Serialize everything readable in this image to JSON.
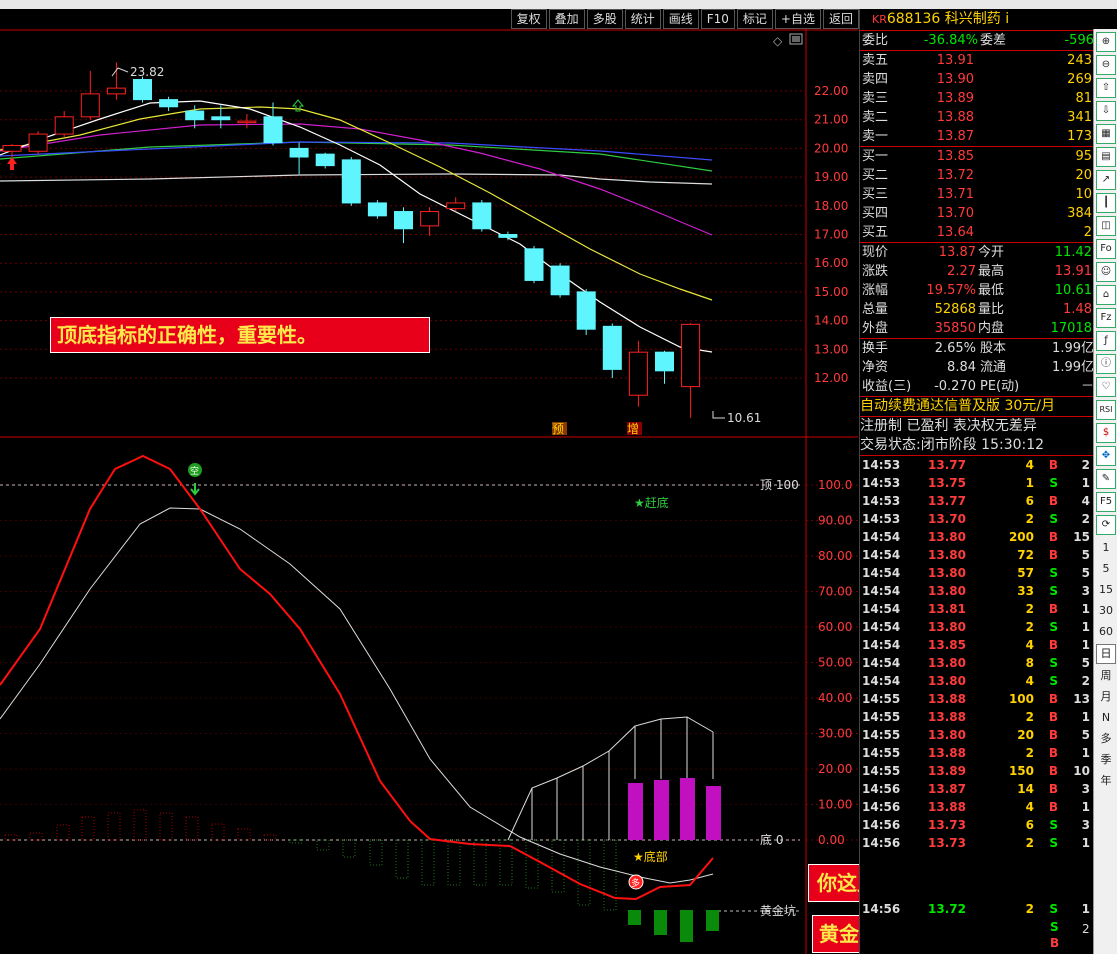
{
  "toolbar": [
    "复权",
    "叠加",
    "多股",
    "统计",
    "画线",
    "F10",
    "标记",
    "+自选",
    "返回"
  ],
  "chart": {
    "price_axis": [
      "22.00",
      "21.00",
      "20.00",
      "19.00",
      "18.00",
      "17.00",
      "16.00",
      "15.00",
      "14.00",
      "13.00",
      "12.00"
    ],
    "high_label": "23.82",
    "low_label": "10.61",
    "sig_yu": "预",
    "sig_zeng": "增",
    "indicator_axis": [
      "100.0",
      "90.00",
      "80.00",
      "70.00",
      "60.00",
      "50.00",
      "40.00",
      "30.00",
      "20.00",
      "10.00",
      "0.00"
    ],
    "top_label": "顶 100",
    "bottom_label": "底 0",
    "gold_label": "黄金坑",
    "gandi_label": "★赶底",
    "dibu_label": "★底部",
    "candles": [
      {
        "o": 19.9,
        "c": 20.1,
        "h": 20.15,
        "l": 19.7
      },
      {
        "o": 19.9,
        "c": 20.5,
        "h": 20.6,
        "l": 19.8
      },
      {
        "o": 20.5,
        "c": 21.1,
        "h": 21.3,
        "l": 20.4
      },
      {
        "o": 21.1,
        "c": 21.9,
        "h": 22.7,
        "l": 21.0
      },
      {
        "o": 21.9,
        "c": 22.1,
        "h": 23.0,
        "l": 21.7
      },
      {
        "o": 22.4,
        "c": 21.7,
        "h": 22.5,
        "l": 21.6
      },
      {
        "o": 21.7,
        "c": 21.45,
        "h": 21.8,
        "l": 21.3
      },
      {
        "o": 21.3,
        "c": 21.0,
        "h": 21.5,
        "l": 20.7
      },
      {
        "o": 21.1,
        "c": 21.0,
        "h": 21.5,
        "l": 20.7
      },
      {
        "o": 20.9,
        "c": 20.95,
        "h": 21.2,
        "l": 20.7
      },
      {
        "o": 21.1,
        "c": 20.2,
        "h": 21.6,
        "l": 20.1
      },
      {
        "o": 20.0,
        "c": 19.7,
        "h": 20.2,
        "l": 19.1
      },
      {
        "o": 19.8,
        "c": 19.4,
        "h": 19.85,
        "l": 19.3
      },
      {
        "o": 19.6,
        "c": 18.1,
        "h": 19.7,
        "l": 18.0
      },
      {
        "o": 18.1,
        "c": 17.65,
        "h": 18.2,
        "l": 17.55
      },
      {
        "o": 17.8,
        "c": 17.2,
        "h": 17.95,
        "l": 16.7
      },
      {
        "o": 17.3,
        "c": 17.8,
        "h": 17.95,
        "l": 16.95
      },
      {
        "o": 17.9,
        "c": 18.1,
        "h": 18.3,
        "l": 17.8
      },
      {
        "o": 18.1,
        "c": 17.2,
        "h": 18.2,
        "l": 17.1
      },
      {
        "o": 17.0,
        "c": 16.9,
        "h": 17.1,
        "l": 16.8
      },
      {
        "o": 16.5,
        "c": 15.4,
        "h": 16.6,
        "l": 15.3
      },
      {
        "o": 15.9,
        "c": 14.9,
        "h": 16.0,
        "l": 14.8
      },
      {
        "o": 15.0,
        "c": 13.7,
        "h": 15.1,
        "l": 13.5
      },
      {
        "o": 13.8,
        "c": 12.3,
        "h": 13.9,
        "l": 12.0
      },
      {
        "o": 11.4,
        "c": 12.9,
        "h": 13.3,
        "l": 11.0
      },
      {
        "o": 12.9,
        "c": 12.25,
        "h": 12.95,
        "l": 11.8
      },
      {
        "o": 11.7,
        "c": 13.87,
        "h": 13.91,
        "l": 10.61
      }
    ]
  },
  "banners": {
    "b1": "顶底指标的正确性，重要性。",
    "b2": "你这里割肉了吗？？",
    "b3": "黄金坑就是恐慌盘"
  },
  "panel": {
    "kr": "KR",
    "code_name": "688136 科兴制药",
    "suffix": "i",
    "weibi_label": "委比",
    "weibi": "-36.84%",
    "weicha_label": "委差",
    "weicha": "-596",
    "asks": [
      {
        "label": "卖五",
        "price": "13.91",
        "vol": "243"
      },
      {
        "label": "卖四",
        "price": "13.90",
        "vol": "269"
      },
      {
        "label": "卖三",
        "price": "13.89",
        "vol": "81"
      },
      {
        "label": "卖二",
        "price": "13.88",
        "vol": "341"
      },
      {
        "label": "卖一",
        "price": "13.87",
        "vol": "173"
      }
    ],
    "bids": [
      {
        "label": "买一",
        "price": "13.85",
        "vol": "95"
      },
      {
        "label": "买二",
        "price": "13.72",
        "vol": "20"
      },
      {
        "label": "买三",
        "price": "13.71",
        "vol": "10"
      },
      {
        "label": "买四",
        "price": "13.70",
        "vol": "384"
      },
      {
        "label": "买五",
        "price": "13.64",
        "vol": "2"
      }
    ],
    "stats": [
      {
        "l1": "现价",
        "v1": "13.87",
        "c1": "red",
        "l2": "今开",
        "v2": "11.42",
        "c2": "grn"
      },
      {
        "l1": "涨跌",
        "v1": "2.27",
        "c1": "red",
        "l2": "最高",
        "v2": "13.91",
        "c2": "red"
      },
      {
        "l1": "涨幅",
        "v1": "19.57%",
        "c1": "red",
        "l2": "最低",
        "v2": "10.61",
        "c2": "grn"
      },
      {
        "l1": "总量",
        "v1": "52868",
        "c1": "yel",
        "l2": "量比",
        "v2": "1.48",
        "c2": "red"
      },
      {
        "l1": "外盘",
        "v1": "35850",
        "c1": "red",
        "l2": "内盘",
        "v2": "17018",
        "c2": "grn"
      }
    ],
    "stats2": [
      {
        "l1": "换手",
        "v1": "2.65%",
        "l2": "股本",
        "v2": "1.99亿"
      },
      {
        "l1": "净资",
        "v1": "8.84",
        "l2": "流通",
        "v2": "1.99亿"
      },
      {
        "l1": "收益(三)",
        "v1": "-0.270",
        "l2": "PE(动)",
        "v2": "－"
      }
    ],
    "promo": "自动续费通达信普及版",
    "promo_price": "30元/月",
    "reg": "注册制 已盈利 表决权无差异",
    "status_label": "交易状态:",
    "status": "闭市阶段",
    "status_time": "15:30:12",
    "ticks": [
      {
        "t": "14:53",
        "p": "13.77",
        "v": "4",
        "s": "B",
        "n": "2"
      },
      {
        "t": "14:53",
        "p": "13.75",
        "v": "1",
        "s": "S",
        "n": "1"
      },
      {
        "t": "14:53",
        "p": "13.77",
        "v": "6",
        "s": "B",
        "n": "4"
      },
      {
        "t": "14:53",
        "p": "13.70",
        "v": "2",
        "s": "S",
        "n": "2"
      },
      {
        "t": "14:54",
        "p": "13.80",
        "v": "200",
        "s": "B",
        "n": "15"
      },
      {
        "t": "14:54",
        "p": "13.80",
        "v": "72",
        "s": "B",
        "n": "5"
      },
      {
        "t": "14:54",
        "p": "13.80",
        "v": "57",
        "s": "S",
        "n": "5"
      },
      {
        "t": "14:54",
        "p": "13.80",
        "v": "33",
        "s": "S",
        "n": "3"
      },
      {
        "t": "14:54",
        "p": "13.81",
        "v": "2",
        "s": "B",
        "n": "1"
      },
      {
        "t": "14:54",
        "p": "13.80",
        "v": "2",
        "s": "S",
        "n": "1"
      },
      {
        "t": "14:54",
        "p": "13.85",
        "v": "4",
        "s": "B",
        "n": "1"
      },
      {
        "t": "14:54",
        "p": "13.80",
        "v": "8",
        "s": "S",
        "n": "5"
      },
      {
        "t": "14:54",
        "p": "13.80",
        "v": "4",
        "s": "S",
        "n": "2"
      },
      {
        "t": "14:55",
        "p": "13.88",
        "v": "100",
        "s": "B",
        "n": "13"
      },
      {
        "t": "14:55",
        "p": "13.88",
        "v": "2",
        "s": "B",
        "n": "1"
      },
      {
        "t": "14:55",
        "p": "13.80",
        "v": "20",
        "s": "B",
        "n": "5"
      },
      {
        "t": "14:55",
        "p": "13.88",
        "v": "2",
        "s": "B",
        "n": "1"
      },
      {
        "t": "14:55",
        "p": "13.89",
        "v": "150",
        "s": "B",
        "n": "10"
      },
      {
        "t": "14:56",
        "p": "13.87",
        "v": "14",
        "s": "B",
        "n": "3"
      },
      {
        "t": "14:56",
        "p": "13.88",
        "v": "4",
        "s": "B",
        "n": "1"
      },
      {
        "t": "14:56",
        "p": "13.73",
        "v": "6",
        "s": "S",
        "n": "3"
      },
      {
        "t": "14:56",
        "p": "13.73",
        "v": "2",
        "s": "S",
        "n": "1"
      }
    ],
    "last_tick": {
      "t": "14:56",
      "p": "13.72",
      "v": "2",
      "s": "S",
      "n": "1"
    }
  },
  "icons": [
    "plus-icon",
    "minus-icon",
    "up-arrow-icon",
    "down-arrow-icon",
    "grid-icon",
    "table-icon",
    "line-icon",
    "candle-icon",
    "fund-icon",
    "f10-icon",
    "person-icon",
    "bank-icon",
    "fz-icon",
    "f-icon",
    "info-icon",
    "heart-icon",
    "rsi-icon",
    "dollar-icon",
    "move-icon",
    "pencil-icon",
    "f5-icon",
    "refresh-icon"
  ],
  "periods": [
    "1",
    "5",
    "15",
    "30",
    "60",
    "日",
    "周",
    "月",
    "N",
    "多",
    "季",
    "年"
  ]
}
